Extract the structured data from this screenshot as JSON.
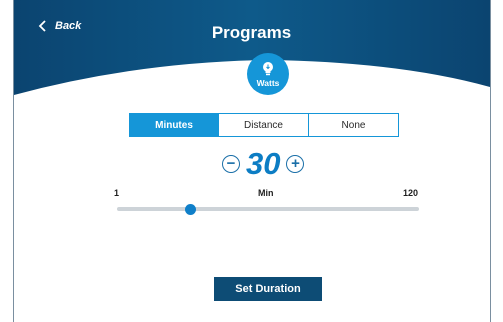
{
  "header": {
    "back_label": "Back",
    "title": "Programs",
    "badge_label": "Watts",
    "badge_icon": "lightbulb-icon"
  },
  "mode_selector": {
    "options": [
      "Minutes",
      "Distance",
      "None"
    ],
    "selected": "Minutes"
  },
  "duration": {
    "value": "30",
    "minus_icon": "minus-circle-icon",
    "plus_icon": "plus-circle-icon"
  },
  "slider": {
    "min_label": "1",
    "unit_label": "Min",
    "max_label": "120",
    "min": 1,
    "max": 120,
    "value": 30
  },
  "actions": {
    "set_duration_label": "Set Duration"
  },
  "colors": {
    "header_dark": "#0d4c75",
    "accent": "#1596d8",
    "value_blue": "#0c7dc4"
  }
}
